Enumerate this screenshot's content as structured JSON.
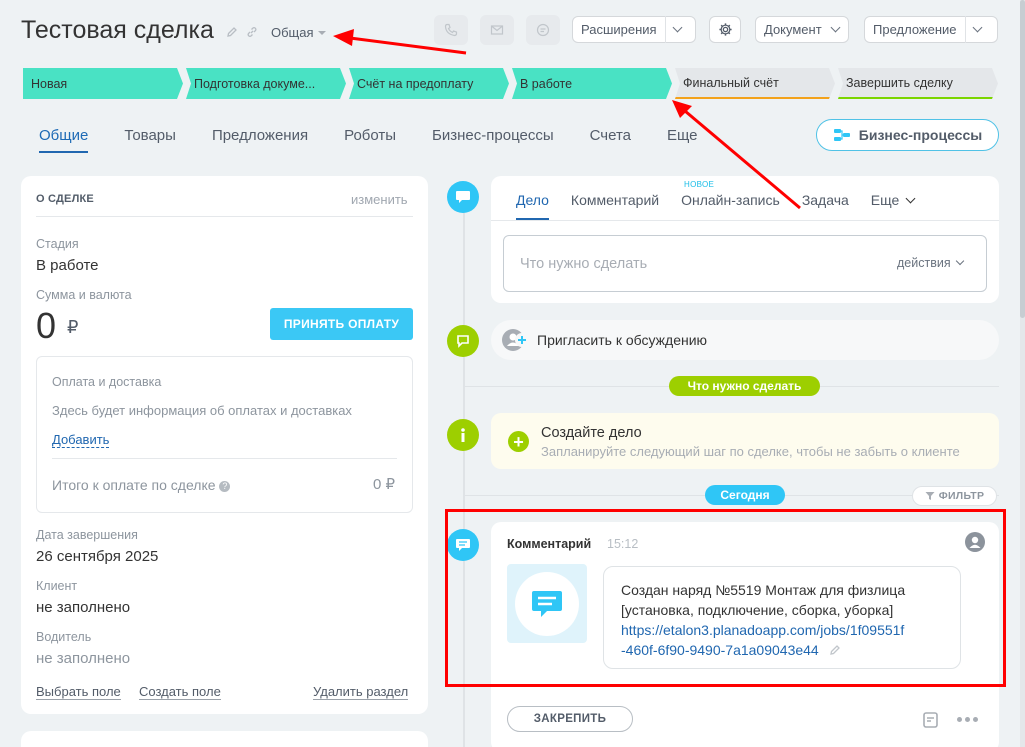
{
  "header": {
    "title": "Тестовая сделка",
    "category": "Общая",
    "buttons": {
      "extensions": "Расширения",
      "document": "Документ",
      "proposal": "Предложение"
    }
  },
  "stages": [
    {
      "label": "Новая",
      "status": "done"
    },
    {
      "label": "Подготовка докуме...",
      "status": "done"
    },
    {
      "label": "Счёт на предоплату",
      "status": "done"
    },
    {
      "label": "В работе",
      "status": "current"
    },
    {
      "label": "Финальный счёт",
      "status": "todo",
      "accent": "#f3a21b"
    },
    {
      "label": "Завершить сделку",
      "status": "todo",
      "accent": "#7bd500"
    }
  ],
  "tabs": [
    "Общие",
    "Товары",
    "Предложения",
    "Роботы",
    "Бизнес-процессы",
    "Счета",
    "Еще"
  ],
  "bp_button": "Бизнес-процессы",
  "deal": {
    "section_title": "О СДЕЛКЕ",
    "edit": "изменить",
    "stage_label": "Стадия",
    "stage_value": "В работе",
    "sum_label": "Сумма и валюта",
    "sum_value": "0",
    "currency": "₽",
    "pay_button": "ПРИНЯТЬ ОПЛАТУ",
    "payment": {
      "title": "Оплата и доставка",
      "info": "Здесь будет информация об оплатах и доставках",
      "add": "Добавить",
      "total_label": "Итого к оплате по сделке",
      "total_value": "0 ₽"
    },
    "close_date_label": "Дата завершения",
    "close_date_value": "26 сентября 2025",
    "client_label": "Клиент",
    "client_value": "не заполнено",
    "driver_label": "Водитель",
    "driver_value": "не заполнено",
    "footer": {
      "choose_field": "Выбрать поле",
      "create_field": "Создать поле",
      "delete_section": "Удалить раздел"
    }
  },
  "activity": {
    "tabs": [
      "Дело",
      "Комментарий",
      "Онлайн-запись",
      "Задача",
      "Еще"
    ],
    "new_tag": "НОВОЕ",
    "placeholder": "Что нужно сделать",
    "actions": "действия"
  },
  "invite": "Пригласить к обсуждению",
  "todo_pill": "Что нужно сделать",
  "create_task": {
    "title": "Создайте дело",
    "subtitle": "Запланируйте следующий шаг по сделке, чтобы не забыть о клиенте"
  },
  "today_pill": "Сегодня",
  "filter": "ФИЛЬТР",
  "comment": {
    "title": "Комментарий",
    "time": "15:12",
    "line1": "Создан наряд №5519 Монтаж для физлица",
    "line2": "[установка, подключение, сборка, уборка]",
    "link1": "https://etalon3.planadoapp.com/jobs/1f09551f",
    "link2": "-460f-6f90-9490-7a1a09043e44",
    "pin": "ЗАКРЕПИТЬ"
  },
  "colors": {
    "stage_done": "#49e2c4",
    "stage_todo": "#e4e7ea",
    "accent_blue": "#2fc6f6",
    "accent_green": "#9dcf00",
    "annotation_red": "#ff0000"
  }
}
